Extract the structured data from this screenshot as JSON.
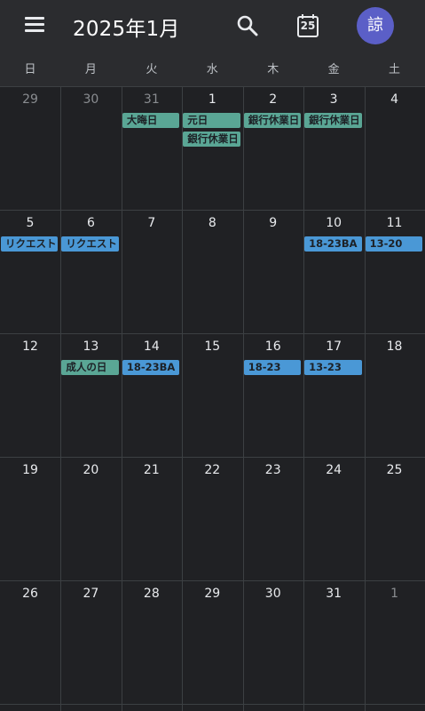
{
  "header": {
    "title": "2025年1月",
    "today_icon_number": "25",
    "avatar_initial": "諒"
  },
  "weekdays": [
    "日",
    "月",
    "火",
    "水",
    "木",
    "金",
    "土"
  ],
  "weeks": [
    {
      "days": [
        "29",
        "30",
        "31",
        "1",
        "2",
        "3",
        "4"
      ]
    },
    {
      "days": [
        "5",
        "6",
        "7",
        "8",
        "9",
        "10",
        "11"
      ]
    },
    {
      "days": [
        "12",
        "13",
        "14",
        "15",
        "16",
        "17",
        "18"
      ]
    },
    {
      "days": [
        "19",
        "20",
        "21",
        "22",
        "23",
        "24",
        "25"
      ]
    },
    {
      "days": [
        "26",
        "27",
        "28",
        "29",
        "30",
        "31",
        "1"
      ]
    }
  ],
  "events": [
    {
      "week": 0,
      "day": 2,
      "slot": 0,
      "label": "大晦日",
      "color": "#5aa695"
    },
    {
      "week": 0,
      "day": 3,
      "slot": 0,
      "label": "元日",
      "color": "#5aa695"
    },
    {
      "week": 0,
      "day": 3,
      "slot": 1,
      "label": "銀行休業日",
      "color": "#5aa695"
    },
    {
      "week": 0,
      "day": 4,
      "slot": 0,
      "label": "銀行休業日",
      "color": "#5aa695"
    },
    {
      "week": 0,
      "day": 5,
      "slot": 0,
      "label": "銀行休業日",
      "color": "#5aa695"
    },
    {
      "week": 1,
      "day": 0,
      "slot": 0,
      "label": "リクエスト",
      "color": "#4a98d6"
    },
    {
      "week": 1,
      "day": 1,
      "slot": 0,
      "label": "リクエスト",
      "color": "#4a98d6"
    },
    {
      "week": 1,
      "day": 5,
      "slot": 0,
      "label": "18-23BA",
      "color": "#4a98d6"
    },
    {
      "week": 1,
      "day": 6,
      "slot": 0,
      "label": "13-20",
      "color": "#4a98d6"
    },
    {
      "week": 2,
      "day": 1,
      "slot": 0,
      "label": "成人の日",
      "color": "#5aa695"
    },
    {
      "week": 2,
      "day": 2,
      "slot": 0,
      "label": "18-23BA",
      "color": "#4a98d6"
    },
    {
      "week": 2,
      "day": 4,
      "slot": 0,
      "label": "18-23",
      "color": "#4a98d6"
    },
    {
      "week": 2,
      "day": 5,
      "slot": 0,
      "label": "13-23",
      "color": "#4a98d6"
    }
  ]
}
